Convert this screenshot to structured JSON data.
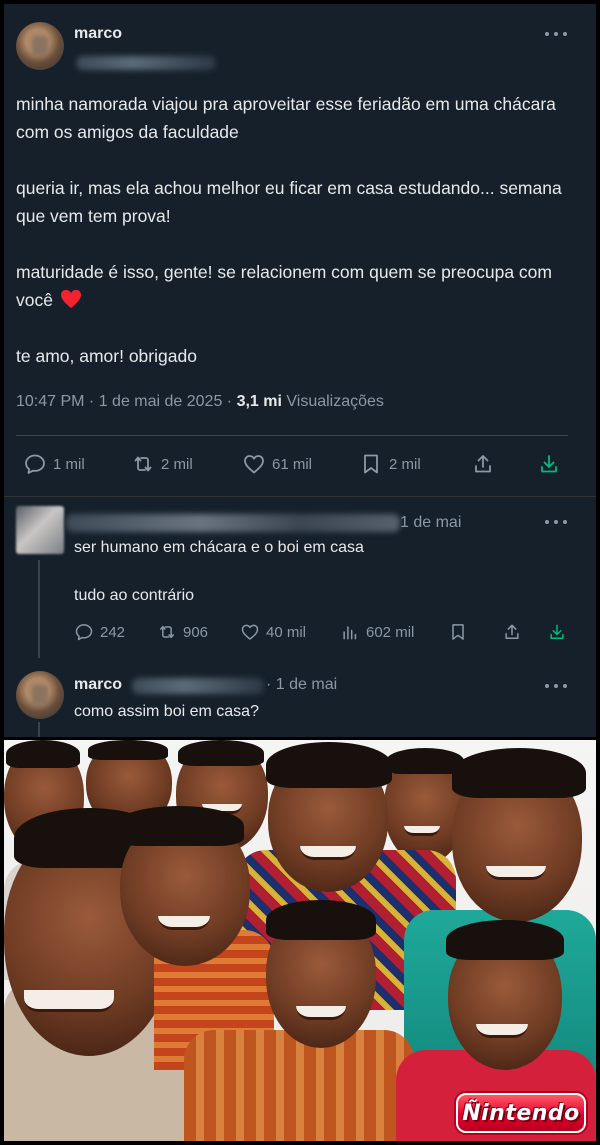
{
  "tweet": {
    "author": "marco",
    "text_paragraphs": [
      "minha namorada viajou pra aproveitar esse feriadão em uma chácara com os amigos da faculdade",
      "queria ir, mas ela achou melhor eu ficar em casa estudando... semana que vem tem prova!",
      "maturidade é isso, gente! se relacionem com quem se preocupa com você",
      "te amo, amor! obrigado"
    ],
    "timestamp": "10:47 PM · 1 de mai de 2025 ·",
    "views_count": "3,1 mi",
    "views_label": "Visualizações",
    "actions": {
      "replies": "1 mil",
      "reposts": "2 mil",
      "likes": "61 mil",
      "bookmarks": "2 mil"
    }
  },
  "reply1": {
    "date": "1 de mai",
    "text_line1": "ser humano em chácara e o boi em casa",
    "text_line2": "tudo ao contrário",
    "actions": {
      "replies": "242",
      "reposts": "906",
      "likes": "40 mil",
      "views": "602 mil"
    }
  },
  "reply2": {
    "author": "marco",
    "date": "· 1 de mai",
    "text": "como assim boi em casa?"
  },
  "meme": {
    "logo_text": "Ñintendo"
  },
  "colors": {
    "background": "#15202b",
    "text": "#e7e9ea",
    "muted": "#8b98a5",
    "heart": "#f4212e",
    "logo_red": "#e4002b"
  }
}
